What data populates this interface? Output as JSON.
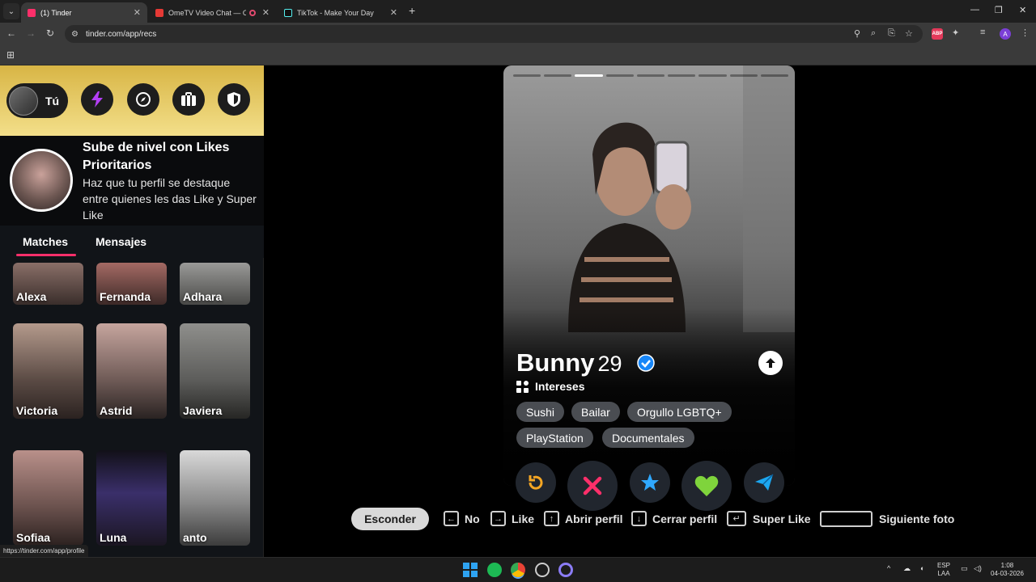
{
  "browser": {
    "tabs": [
      {
        "title": "(1) Tinder",
        "active": true
      },
      {
        "title": "OmeTV Video Chat — Ome",
        "active": false
      },
      {
        "title": "TikTok - Make Your Day",
        "active": false
      }
    ],
    "url": "tinder.com/app/recs",
    "profile_initial": "A",
    "abp_label": "ABP"
  },
  "sidebar": {
    "you_label": "Tú",
    "promo": {
      "title": "Sube de nivel con Likes Prioritarios",
      "text": "Haz que tu perfil se destaque entre quienes les das Like y Super Like"
    },
    "tabs": [
      "Matches",
      "Mensajes"
    ],
    "matches": [
      "Alexa",
      "Fernanda",
      "Adhara",
      "Victoria",
      "Astrid",
      "Javiera",
      "Sofiaa",
      "Luna",
      "anto"
    ]
  },
  "status_url": "https://tinder.com/app/profile",
  "profile": {
    "name": "Bunny",
    "age": "29",
    "verified": true,
    "photo_count": 9,
    "current_photo": 3,
    "interests_label": "Intereses",
    "interests": [
      "Sushi",
      "Bailar",
      "Orgullo LGBTQ+",
      "PlayStation",
      "Documentales"
    ]
  },
  "actions": [
    "rewind",
    "nope",
    "super-like",
    "like",
    "boost"
  ],
  "hints": {
    "hide": "Esconder",
    "no": "No",
    "like": "Like",
    "open": "Abrir perfil",
    "close": "Cerrar perfil",
    "super": "Super Like",
    "next": "Siguiente foto"
  },
  "taskbar": {
    "lang_top": "ESP",
    "lang_bottom": "LAA",
    "time": "1:08",
    "date": "04-03-2026"
  },
  "colors": {
    "tinder_pink": "#fd2f6a",
    "gold_gradient_top": "#d8b545",
    "gold_gradient_bottom": "#f3df8a",
    "chip_bg": "#4a4d52",
    "verified_blue": "#1786f8"
  }
}
